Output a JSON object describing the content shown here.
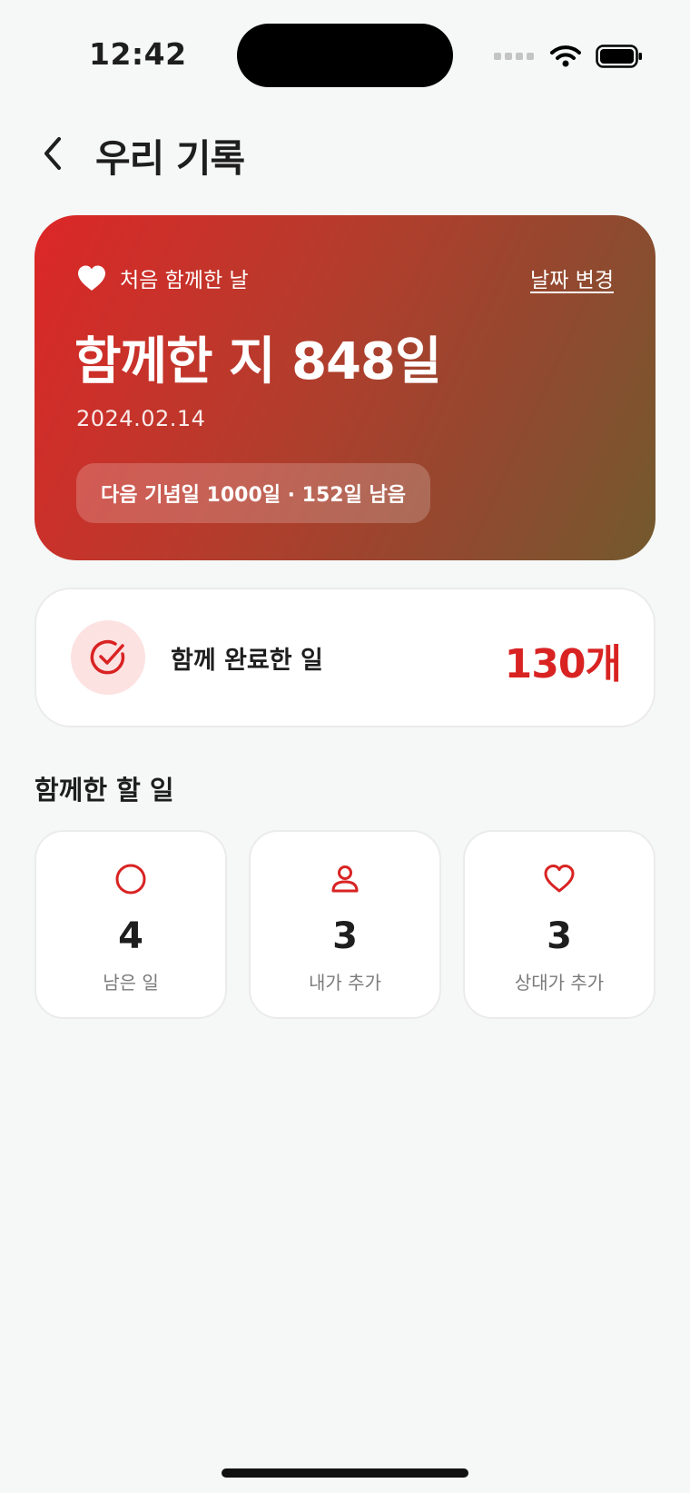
{
  "status_bar": {
    "time": "12:42"
  },
  "header": {
    "title": "우리 기록"
  },
  "hero": {
    "label": "처음 함께한 날",
    "change_link": "날짜 변경",
    "days_text": "함께한 지 848일",
    "date": "2024.02.14",
    "next_anniversary": "다음 기념일 1000일 · 152일 남음"
  },
  "completed": {
    "label": "함께 완료한 일",
    "count": "130개"
  },
  "section": {
    "title": "함께한 할 일"
  },
  "stats": [
    {
      "value": "4",
      "label": "남은 일",
      "icon": "circle-icon"
    },
    {
      "value": "3",
      "label": "내가 추가",
      "icon": "person-icon"
    },
    {
      "value": "3",
      "label": "상대가 추가",
      "icon": "heart-outline-icon"
    }
  ],
  "colors": {
    "accent": "#d92323",
    "background": "#f5f8f7",
    "hero_start": "#dc2727",
    "hero_end": "#735a2e"
  }
}
